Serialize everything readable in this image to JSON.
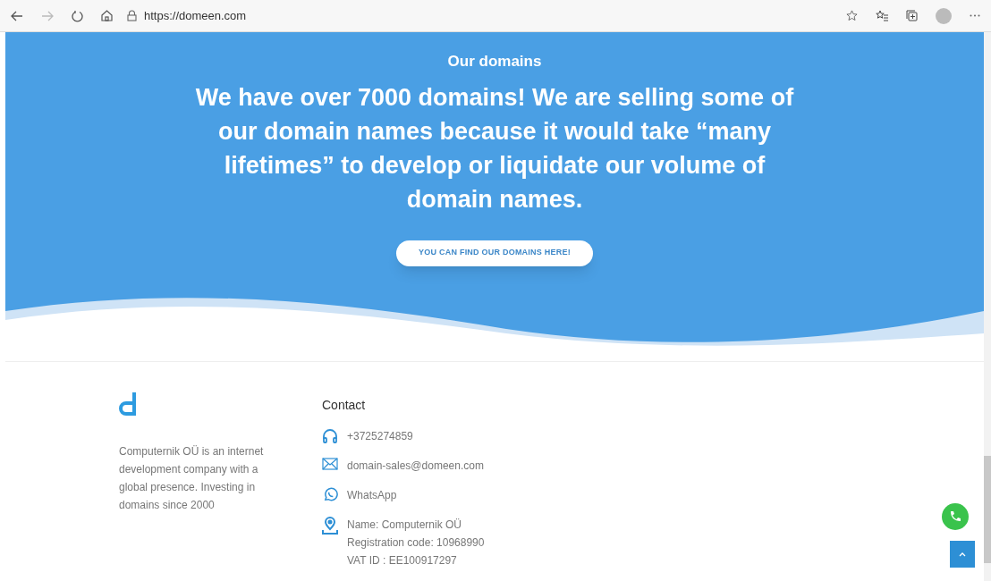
{
  "browser": {
    "url": "https://domeen.com"
  },
  "hero": {
    "eyebrow": "Our domains",
    "heading": "We have over 7000 domains! We are selling some of our domain names because it would take “many lifetimes” to develop or liquidate our volume of domain names.",
    "button": "YOU CAN FIND OUR DOMAINS HERE!"
  },
  "footer": {
    "about": "Computernik OÜ is an internet development company with a global presence. Investing in domains since 2000",
    "contact_title": "Contact",
    "contacts": [
      {
        "kind": "phone",
        "lines": [
          "+3725274859"
        ]
      },
      {
        "kind": "email",
        "lines": [
          "domain-sales@domeen.com"
        ]
      },
      {
        "kind": "whatsapp",
        "lines": [
          "WhatsApp"
        ]
      },
      {
        "kind": "address",
        "lines": [
          "Name: Computernik OÜ",
          "Registration code: 10968990",
          "VAT ID : EE100917297"
        ]
      }
    ]
  }
}
